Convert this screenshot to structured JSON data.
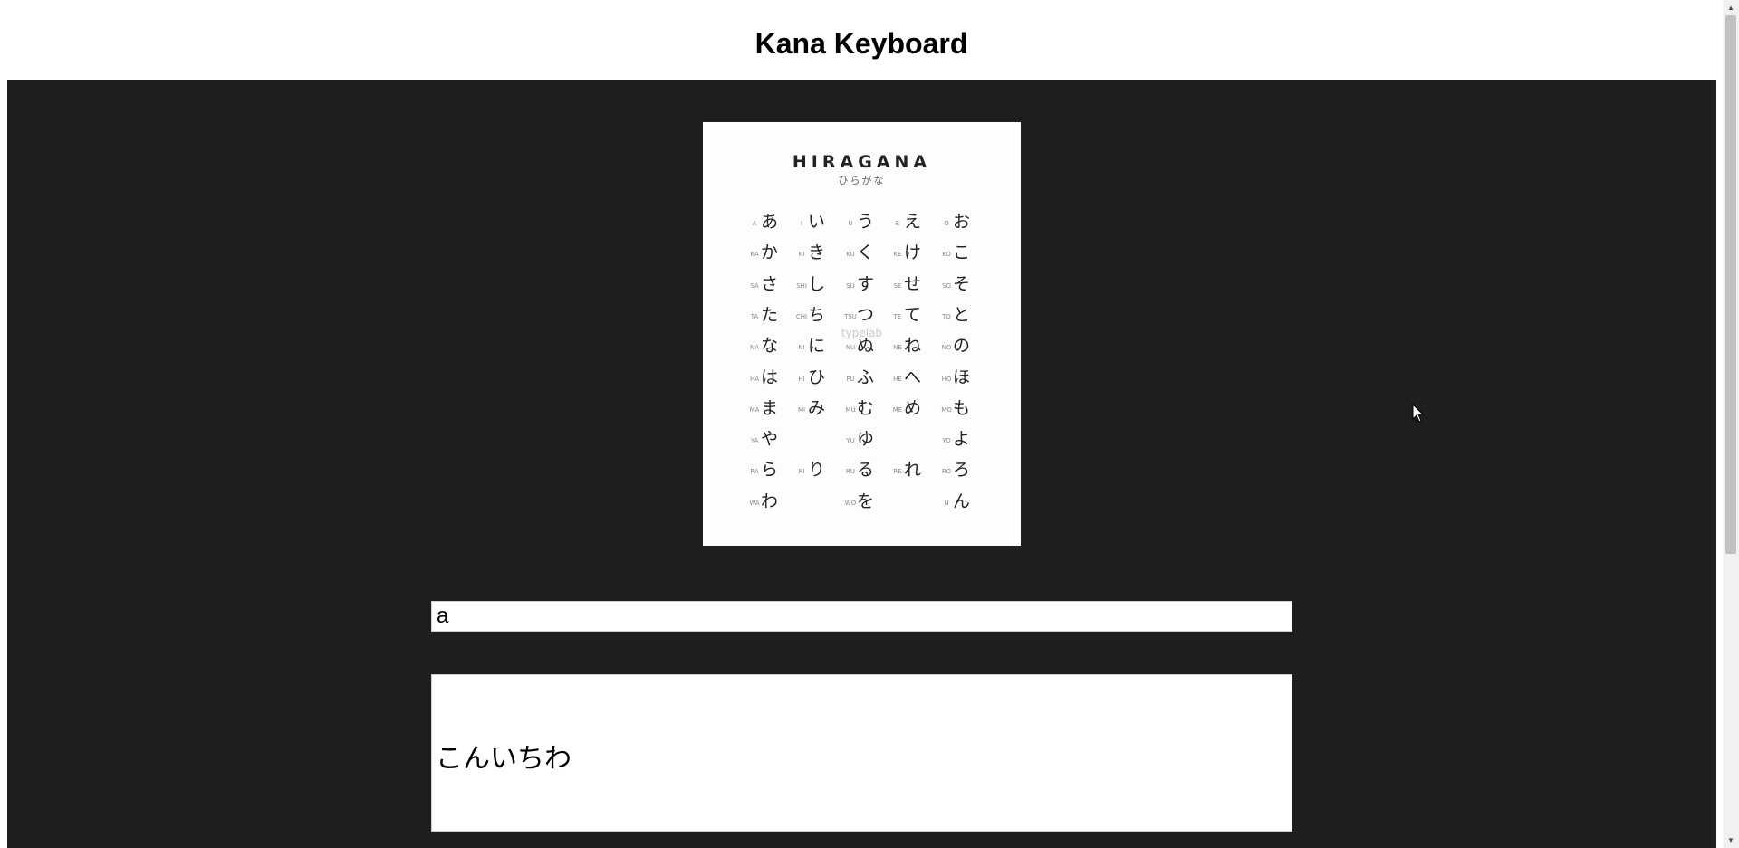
{
  "header": {
    "title": "Kana Keyboard"
  },
  "chart": {
    "title": "HIRAGANA",
    "subtitle": "ひらがな",
    "watermark": "typelab",
    "rows": [
      [
        [
          "A",
          "あ"
        ],
        [
          "I",
          "い"
        ],
        [
          "U",
          "う"
        ],
        [
          "E",
          "え"
        ],
        [
          "O",
          "お"
        ]
      ],
      [
        [
          "KA",
          "か"
        ],
        [
          "KI",
          "き"
        ],
        [
          "KU",
          "く"
        ],
        [
          "KE",
          "け"
        ],
        [
          "KO",
          "こ"
        ]
      ],
      [
        [
          "SA",
          "さ"
        ],
        [
          "SHI",
          "し"
        ],
        [
          "SU",
          "す"
        ],
        [
          "SE",
          "せ"
        ],
        [
          "SO",
          "そ"
        ]
      ],
      [
        [
          "TA",
          "た"
        ],
        [
          "CHI",
          "ち"
        ],
        [
          "TSU",
          "つ"
        ],
        [
          "TE",
          "て"
        ],
        [
          "TO",
          "と"
        ]
      ],
      [
        [
          "NA",
          "な"
        ],
        [
          "NI",
          "に"
        ],
        [
          "NU",
          "ぬ"
        ],
        [
          "NE",
          "ね"
        ],
        [
          "NO",
          "の"
        ]
      ],
      [
        [
          "HA",
          "は"
        ],
        [
          "HI",
          "ひ"
        ],
        [
          "FU",
          "ふ"
        ],
        [
          "HE",
          "へ"
        ],
        [
          "HO",
          "ほ"
        ]
      ],
      [
        [
          "MA",
          "ま"
        ],
        [
          "MI",
          "み"
        ],
        [
          "MU",
          "む"
        ],
        [
          "ME",
          "め"
        ],
        [
          "MO",
          "も"
        ]
      ],
      [
        [
          "YA",
          "や"
        ],
        null,
        [
          "YU",
          "ゆ"
        ],
        null,
        [
          "YO",
          "よ"
        ]
      ],
      [
        [
          "RA",
          "ら"
        ],
        [
          "RI",
          "り"
        ],
        [
          "RU",
          "る"
        ],
        [
          "RE",
          "れ"
        ],
        [
          "RO",
          "ろ"
        ]
      ],
      [
        [
          "WA",
          "わ"
        ],
        null,
        [
          "WO",
          "を"
        ],
        null,
        [
          "N",
          "ん"
        ]
      ]
    ]
  },
  "input": {
    "value": "a",
    "placeholder": ""
  },
  "output": {
    "text": "こんいちわ"
  },
  "icons": {
    "cursor": "mouse-pointer-icon",
    "scroll_up": "scroll-up-arrow-icon",
    "scroll_down": "scroll-down-arrow-icon"
  }
}
